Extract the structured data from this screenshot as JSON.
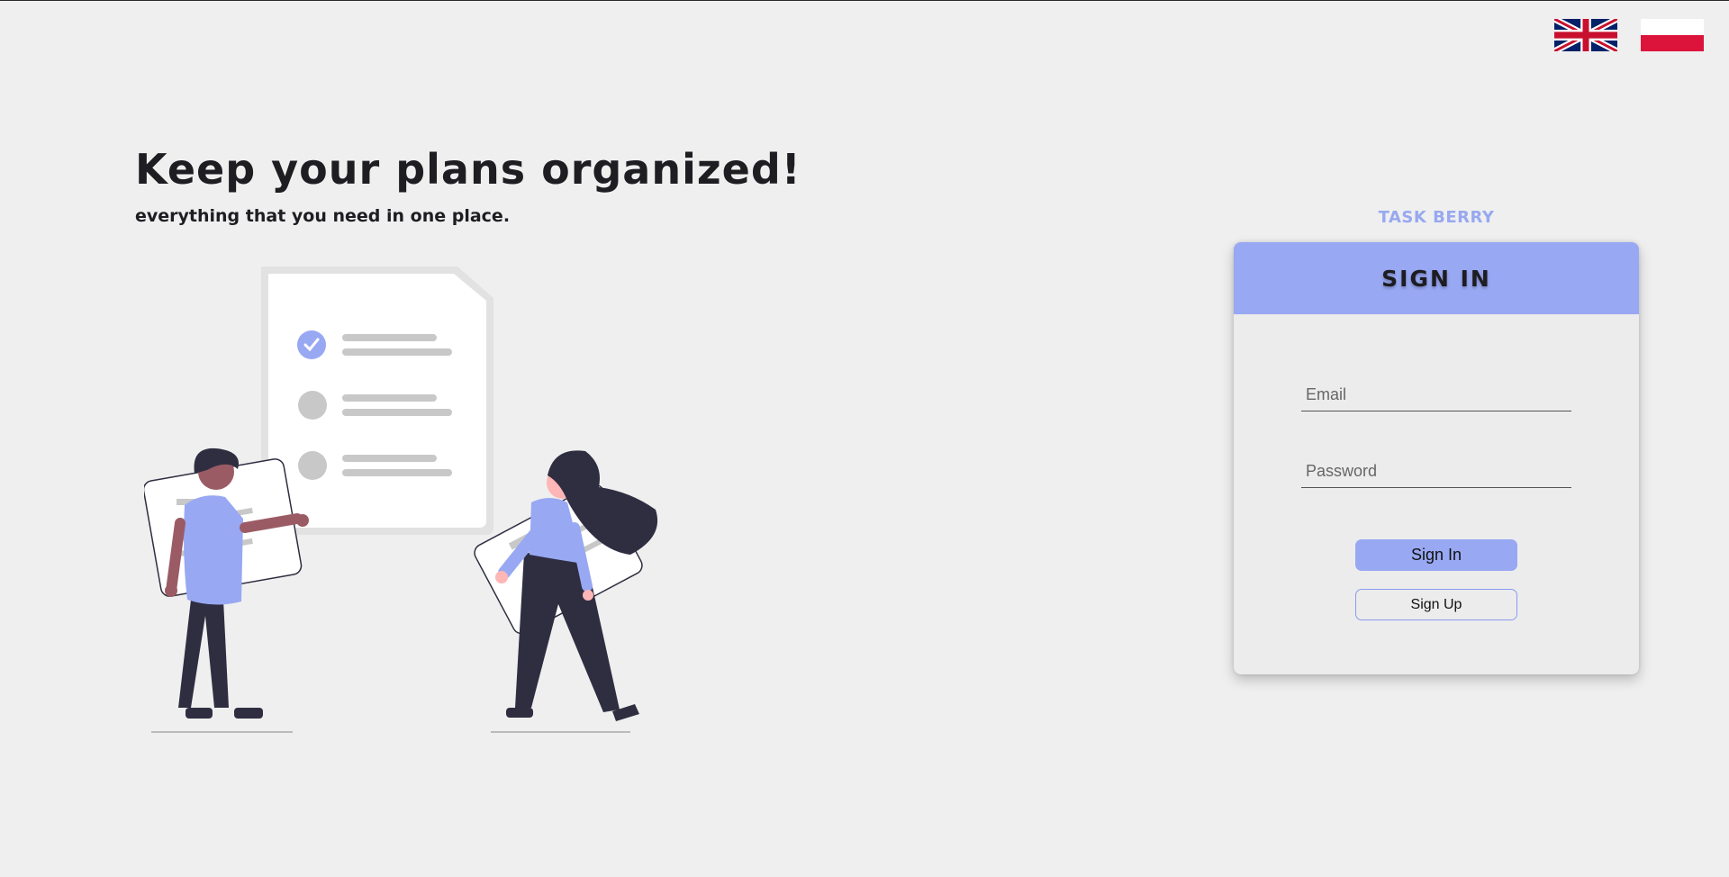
{
  "flags": [
    {
      "icon": "uk-flag-icon",
      "lang": "en"
    },
    {
      "icon": "poland-flag-icon",
      "lang": "pl"
    }
  ],
  "hero": {
    "title": "Keep your plans organized!",
    "subtitle": "everything that you need in one place."
  },
  "brand": "TASK BERRY",
  "signin": {
    "header": "SIGN IN",
    "email_placeholder": "Email",
    "password_placeholder": "Password",
    "signin_button": "Sign In",
    "signup_button": "Sign Up"
  },
  "colors": {
    "accent": "#98a8f3",
    "background": "#efefef",
    "text": "#1d1d22",
    "card": "#ececec"
  }
}
